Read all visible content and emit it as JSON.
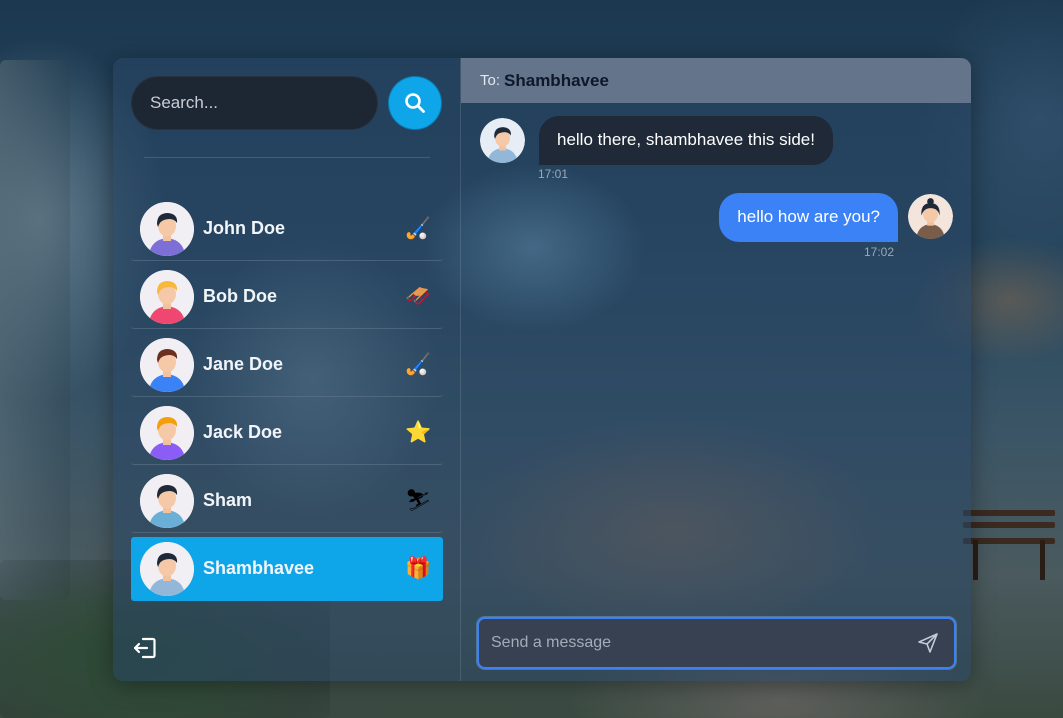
{
  "search": {
    "placeholder": "Search..."
  },
  "contacts": [
    {
      "name": "John Doe",
      "emoji": "🏑",
      "avatar_color": "#7c6fd6",
      "skin": "#f5c9a8",
      "hair": "#1f2937"
    },
    {
      "name": "Bob Doe",
      "emoji": "🛷",
      "avatar_color": "#ef476f",
      "skin": "#f5c9a8",
      "hair": "#f6b93b"
    },
    {
      "name": "Jane Doe",
      "emoji": "🏑",
      "avatar_color": "#3b82f6",
      "skin": "#f5c9a8",
      "hair": "#6b2e1f"
    },
    {
      "name": "Jack Doe",
      "emoji": "⭐",
      "avatar_color": "#8b5cf6",
      "skin": "#f5c9a8",
      "hair": "#f59e0b"
    },
    {
      "name": "Sham",
      "emoji": "⛷",
      "avatar_color": "#6ab0d6",
      "skin": "#f5c9a8",
      "hair": "#1f2937"
    },
    {
      "name": "Shambhavee",
      "emoji": "🎁",
      "avatar_color": "#93b7d9",
      "skin": "#f5c9a8",
      "hair": "#1f2937",
      "active": true
    }
  ],
  "chat": {
    "to_label": "To:",
    "to_name": "Shambhavee",
    "messages": [
      {
        "direction": "incoming",
        "text": "hello there, shambhavee this side!",
        "time": "17:01"
      },
      {
        "direction": "outgoing",
        "text": "hello how are you?",
        "time": "17:02"
      }
    ],
    "composer_placeholder": "Send a message"
  },
  "colors": {
    "accent": "#0ea5e9",
    "outgoing_bubble": "#3b82f6",
    "incoming_bubble": "#1f2937",
    "header": "#64748b"
  },
  "icons": {
    "search": "search-icon",
    "logout": "logout-icon",
    "send": "send-icon"
  }
}
